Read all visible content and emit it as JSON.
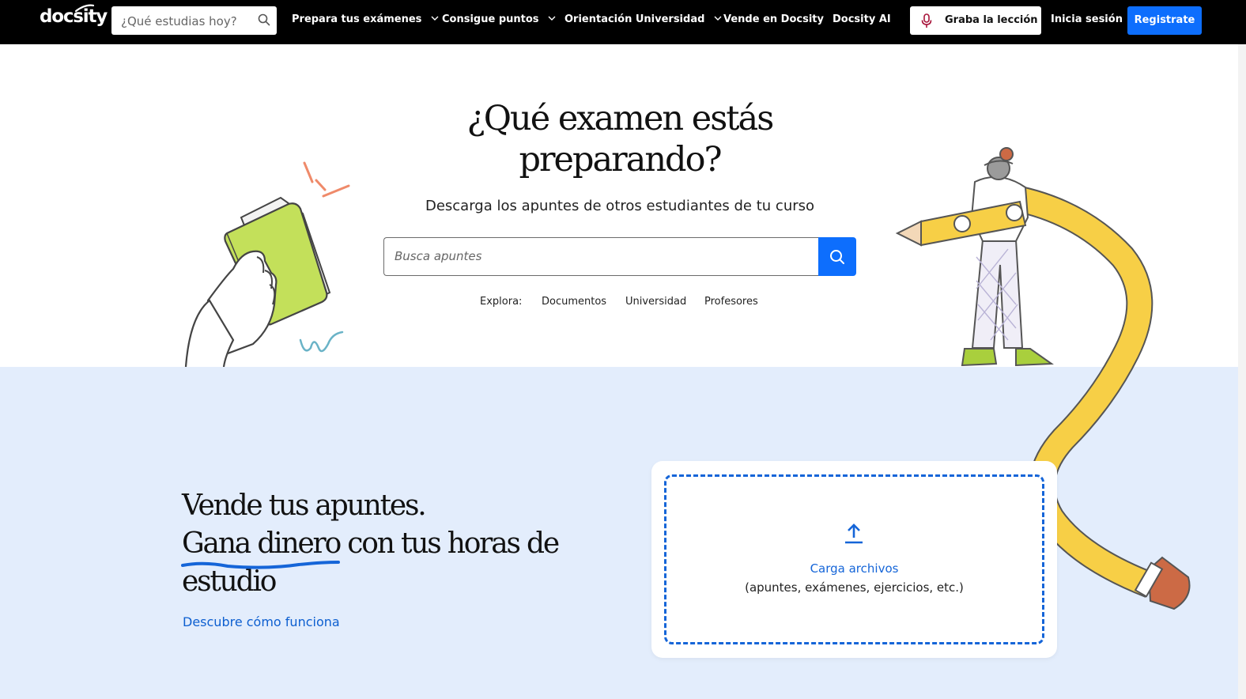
{
  "nav": {
    "logo": "docsity",
    "search_placeholder": "¿Qué estudias hoy?",
    "items": [
      {
        "label": "Prepara tus exámenes",
        "has_dropdown": true
      },
      {
        "label": "Consigue puntos",
        "has_dropdown": true
      },
      {
        "label": "Orientación Universidad",
        "has_dropdown": true
      },
      {
        "label": "Vende en Docsity",
        "has_dropdown": false
      },
      {
        "label": "Docsity AI",
        "has_dropdown": false
      }
    ],
    "record_label": "Graba la lección",
    "login_label": "Inicia sesión",
    "register_label": "Registrate"
  },
  "hero": {
    "title_line1": "¿Qué examen estás",
    "title_line2": "preparando?",
    "subtitle": "Descarga los apuntes de otros estudiantes de tu curso",
    "search_placeholder": "Busca apuntes",
    "explore_label": "Explora:",
    "explore_links": [
      "Documentos",
      "Universidad",
      "Profesores"
    ]
  },
  "sell": {
    "line1": "Vende tus apuntes.",
    "line2_highlight": "Gana dinero",
    "line2_rest": " con tus horas de",
    "line3": "estudio",
    "link": "Descubre cómo funciona"
  },
  "upload": {
    "label": "Carga archivos",
    "hint": "(apuntes, exámenes, ejercicios, etc.)"
  },
  "colors": {
    "nav_bg": "#000000",
    "accent_blue": "#0d6efd",
    "section_bg": "#e3edfc",
    "link_blue": "#1565d8",
    "pencil_yellow": "#f7cf46",
    "book_green": "#c3e05a"
  },
  "icons": [
    "search-icon",
    "chevron-down-icon",
    "microphone-icon",
    "upload-icon"
  ]
}
